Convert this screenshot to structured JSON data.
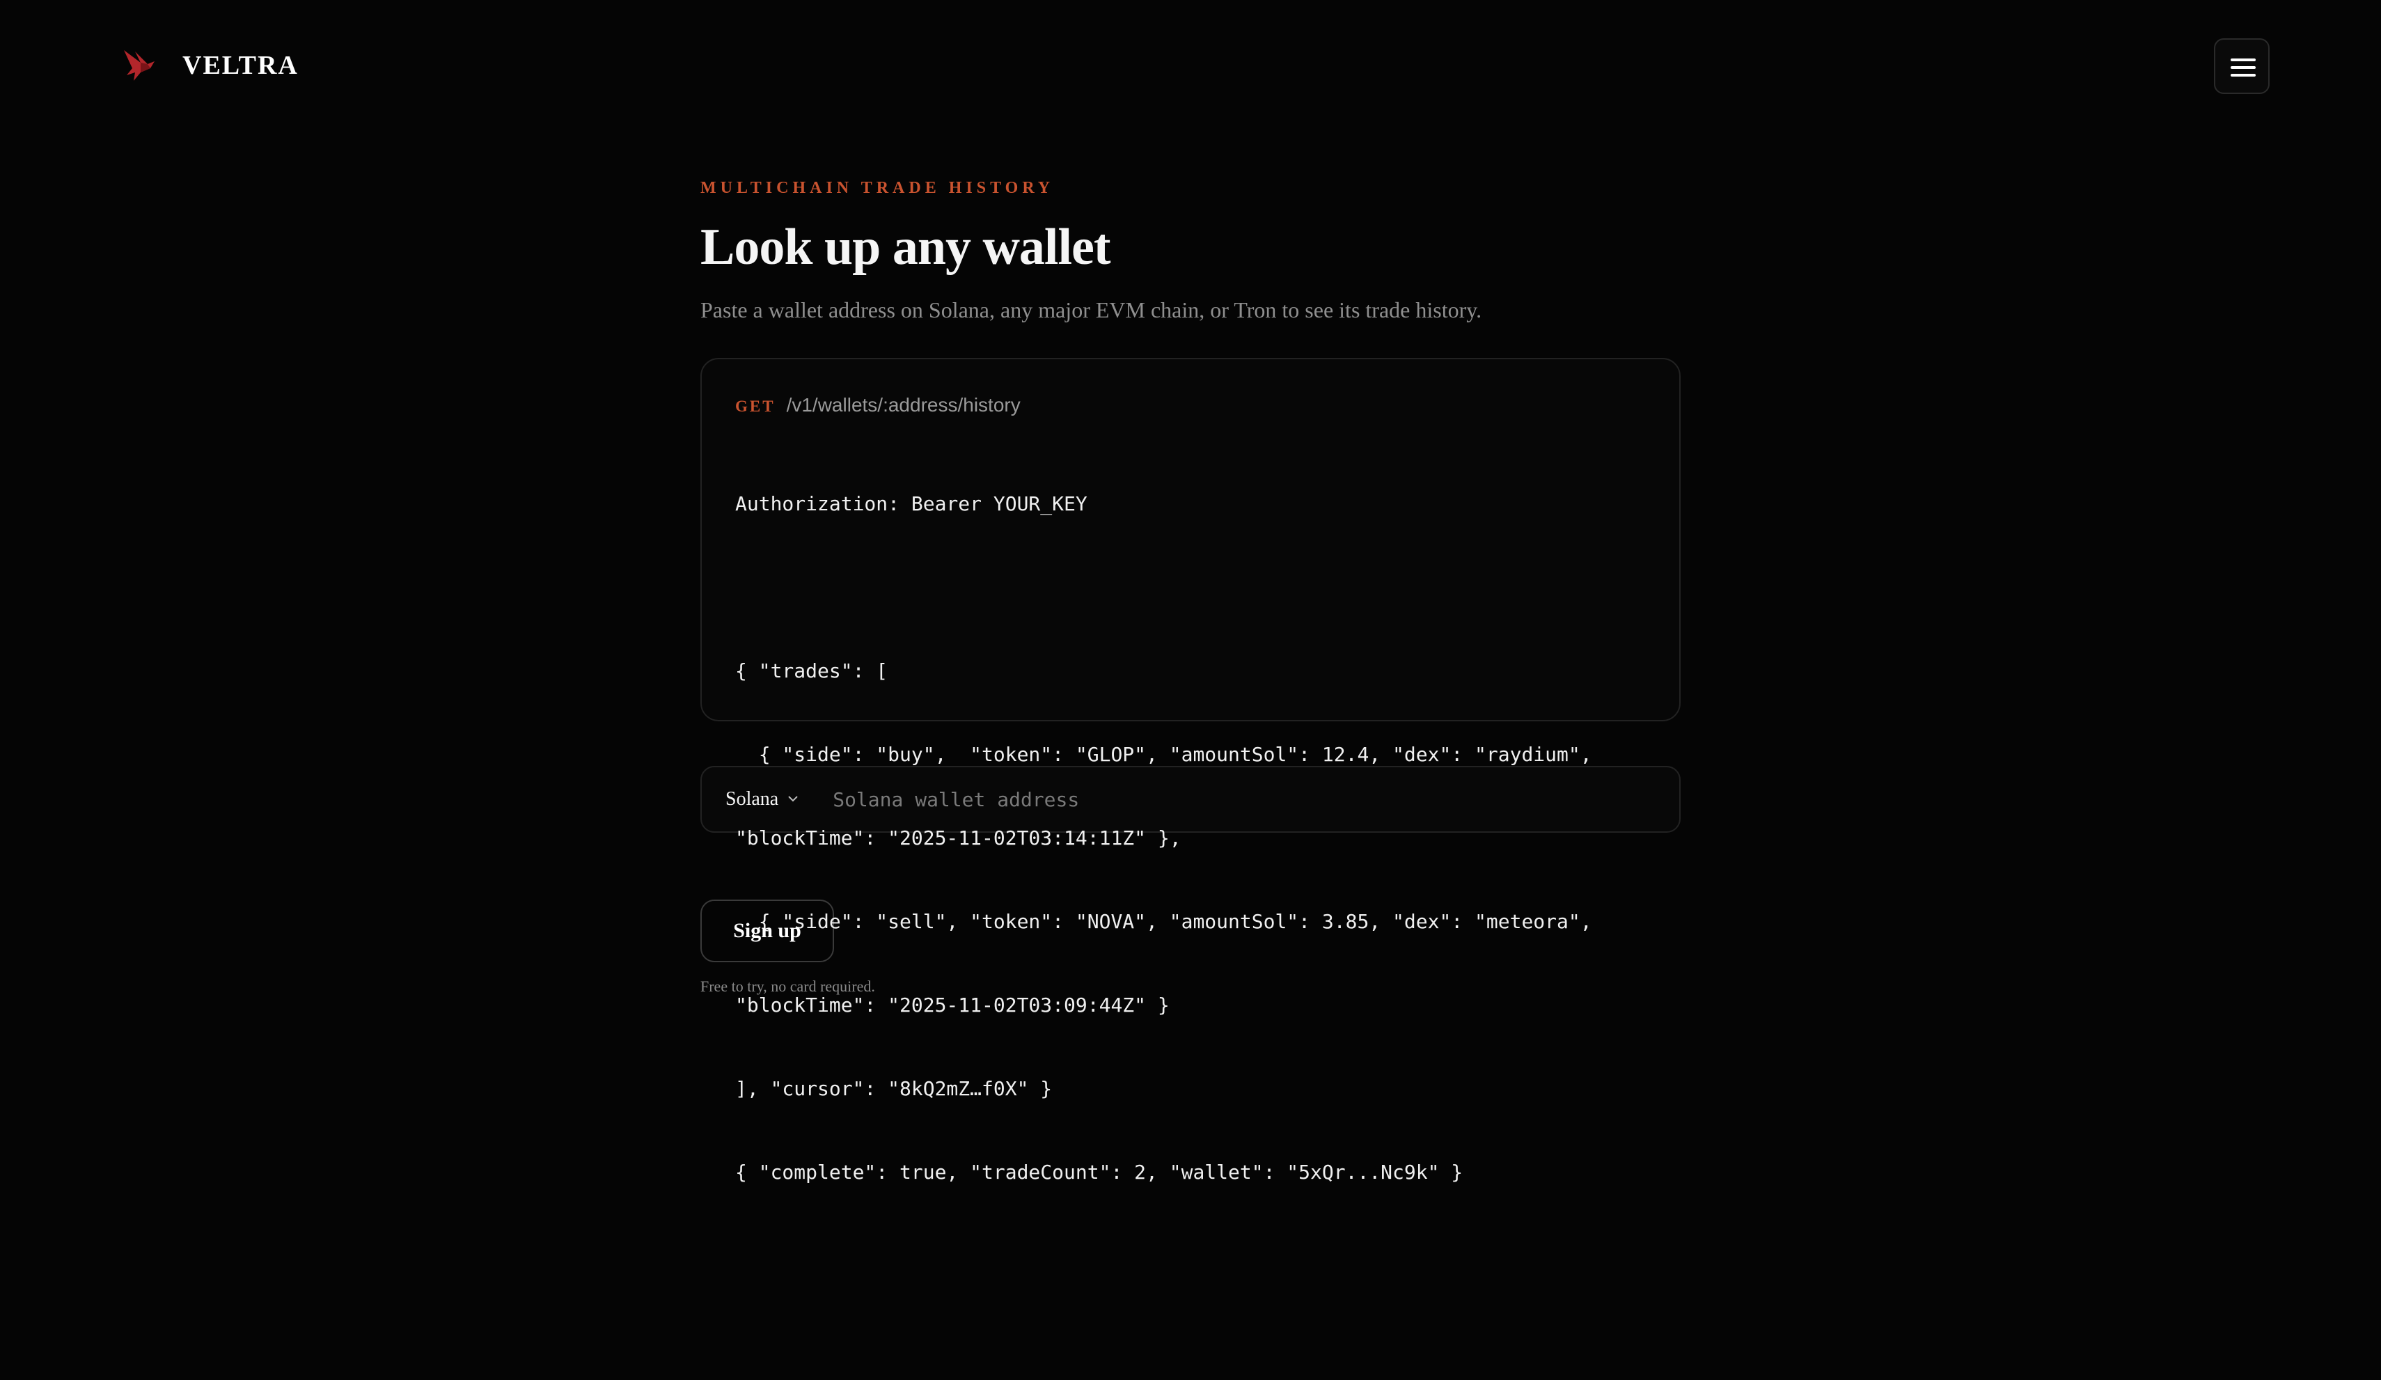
{
  "header": {
    "brand": "VELTRA",
    "logo_icon": "bird-logo-icon",
    "menu_icon": "hamburger-menu-icon",
    "accent_color": "#c9532f"
  },
  "hero": {
    "eyebrow": "MULTICHAIN TRADE HISTORY",
    "title": "Look up any wallet",
    "subtitle": "Paste a wallet address on Solana, any major EVM chain, or Tron to see its trade history."
  },
  "code_card": {
    "method": "GET",
    "path": "/v1/wallets/:address/history",
    "auth_line": "Authorization: Bearer YOUR_KEY",
    "lines": [
      "{ \"trades\": [",
      "  { \"side\": \"buy\",  \"token\": \"GLOP\", \"amountSol\": 12.4, \"dex\": \"raydium\",",
      "\"blockTime\": \"2025-11-02T03:14:11Z\" },",
      "  { \"side\": \"sell\", \"token\": \"NOVA\", \"amountSol\": 3.85, \"dex\": \"meteora\",",
      "\"blockTime\": \"2025-11-02T03:09:44Z\" }",
      "], \"cursor\": \"8kQ2mZ…f0X\" }",
      "{ \"complete\": true, \"tradeCount\": 2, \"wallet\": \"5xQr...Nc9k\" }"
    ]
  },
  "search": {
    "chain_selected": "Solana",
    "chevron_icon": "chevron-down-icon",
    "placeholder": "Solana wallet address",
    "value": ""
  },
  "cta": {
    "signup_label": "Sign up",
    "fineprint": "Free to try, no card required."
  }
}
